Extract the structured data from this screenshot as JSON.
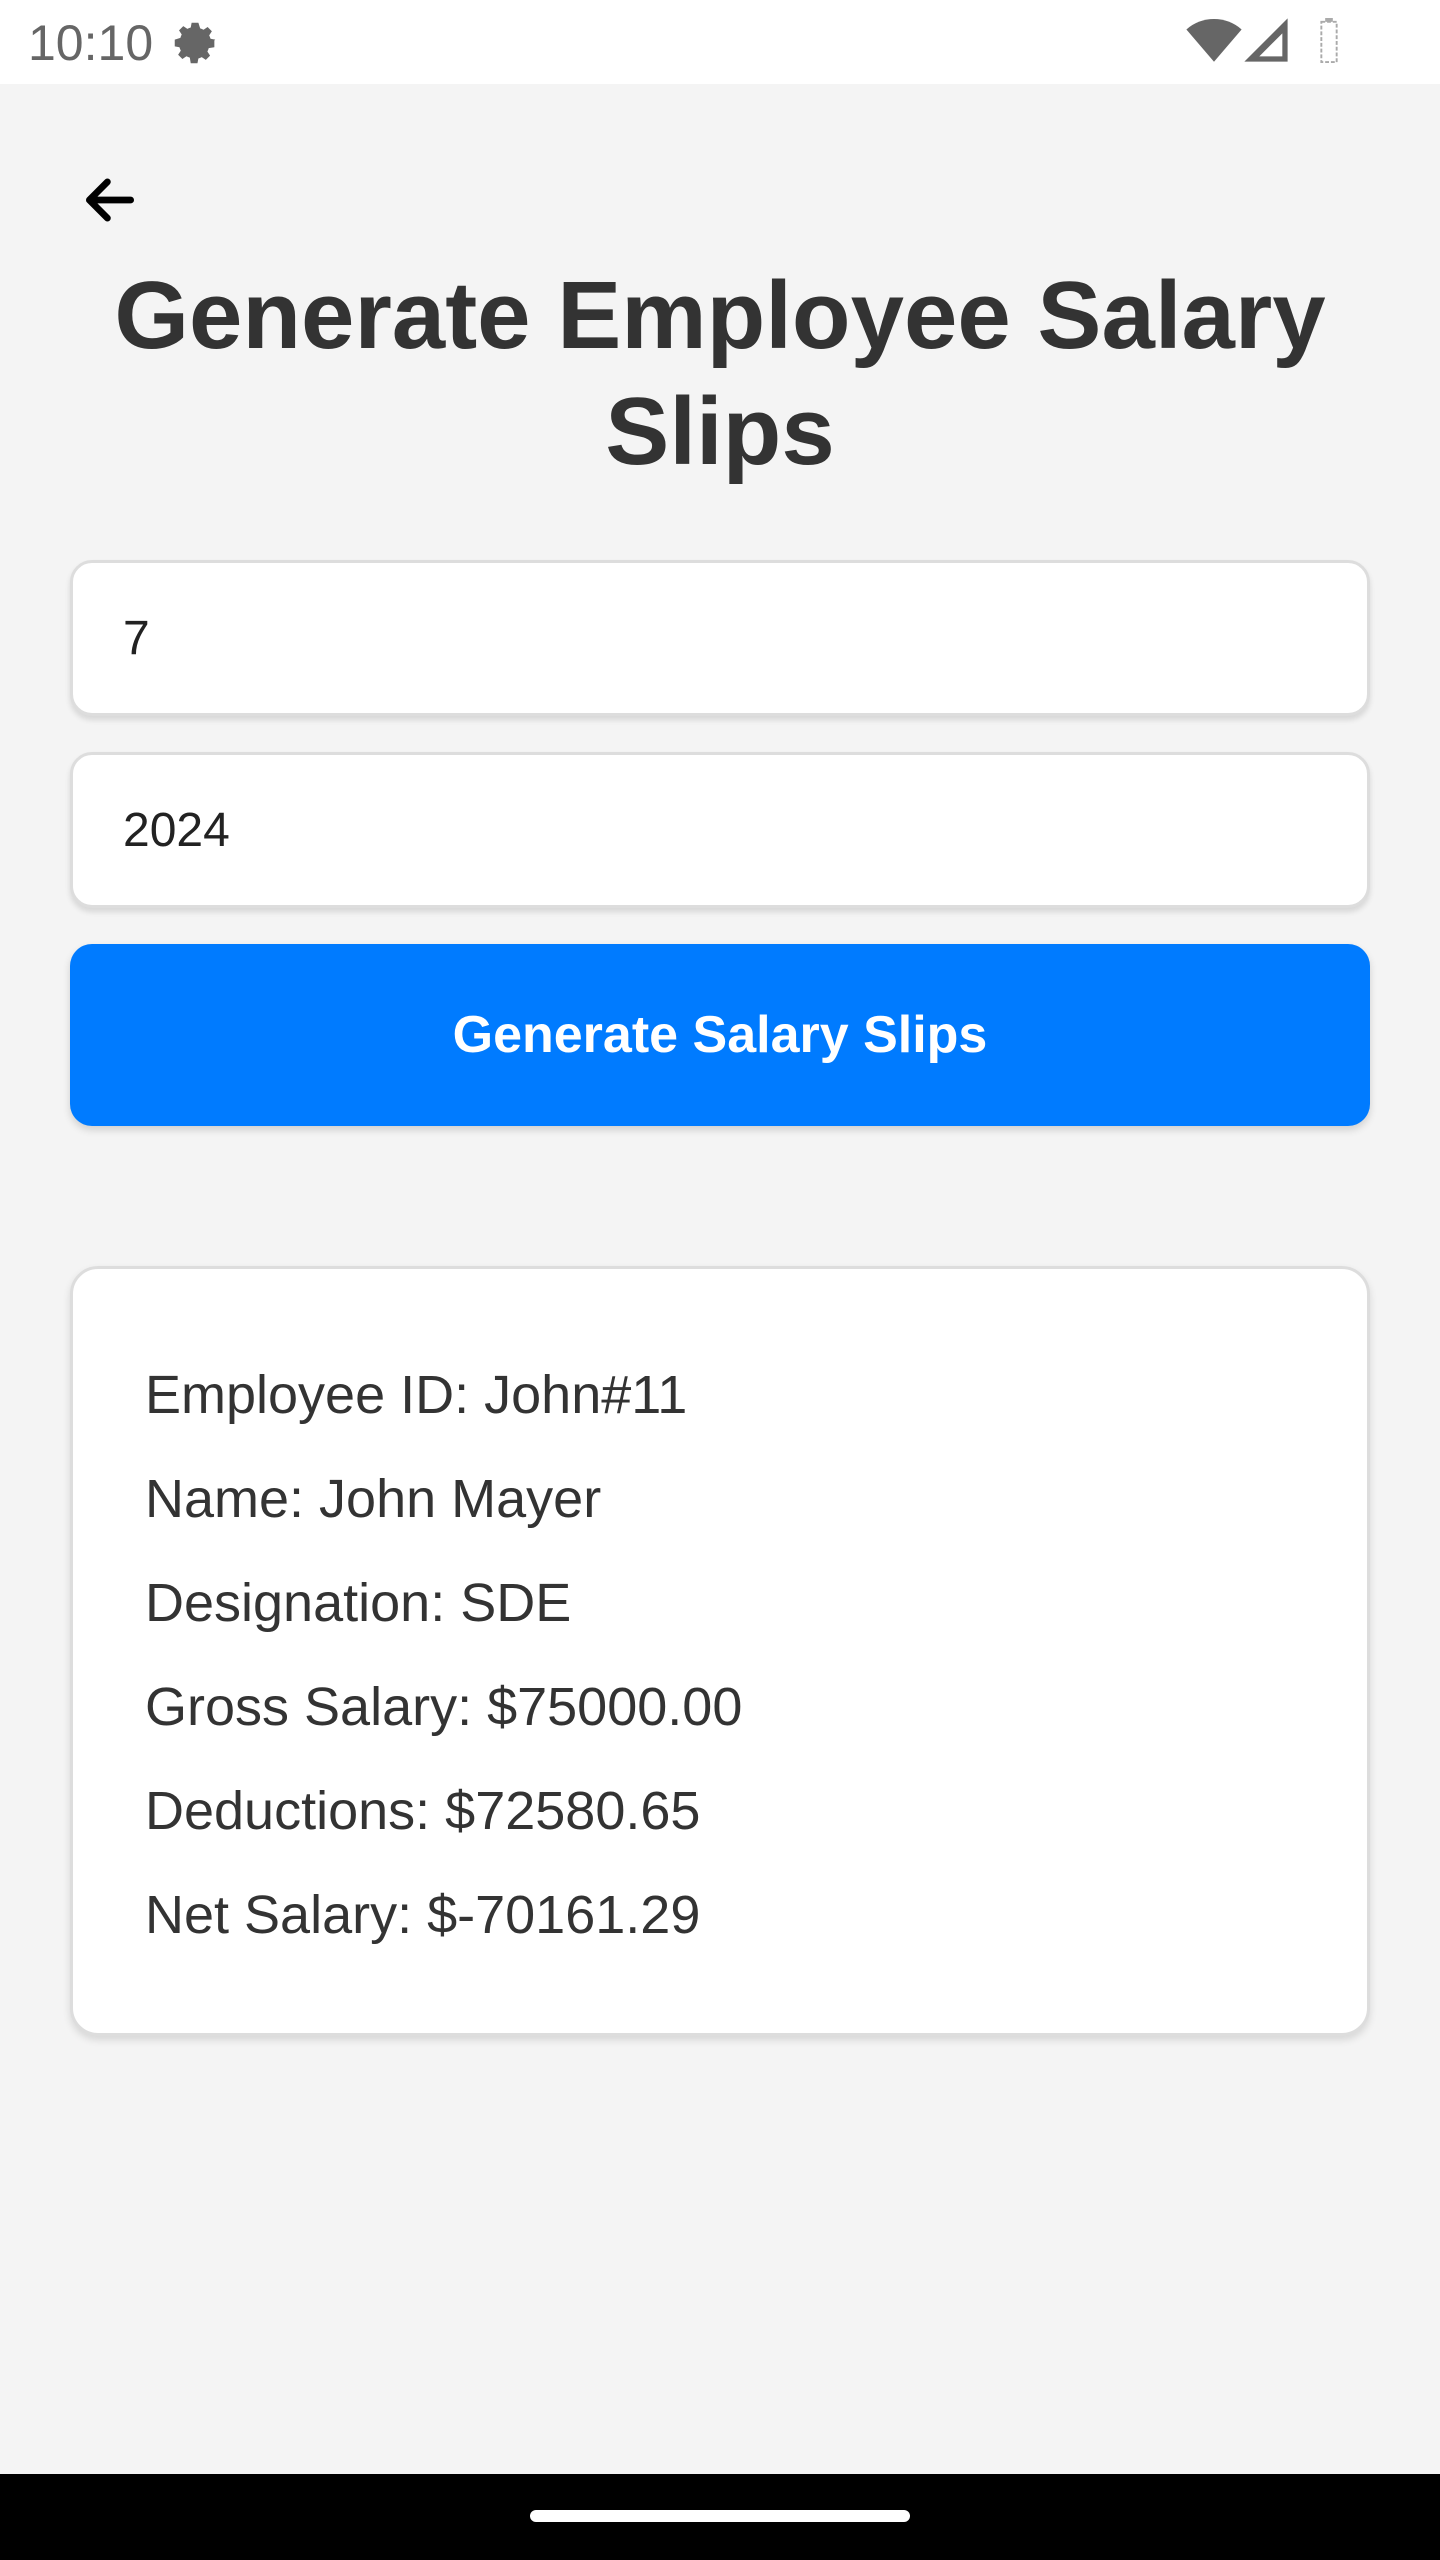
{
  "status_bar": {
    "time": "10:10",
    "icons": [
      "gear-icon",
      "wifi-icon",
      "signal-icon",
      "battery-icon"
    ]
  },
  "header": {
    "back_icon": "arrow-left-icon",
    "title": "Generate Employee Salary Slips"
  },
  "form": {
    "month_value": "7",
    "year_value": "2024",
    "generate_label": "Generate Salary Slips"
  },
  "slip": {
    "employee_id": "Employee ID: John#11",
    "name": "Name: John Mayer",
    "designation": "Designation: SDE",
    "gross_salary": "Gross Salary: $75000.00",
    "deductions": "Deductions: $72580.65",
    "net_salary": "Net Salary: $-70161.29"
  },
  "colors": {
    "accent": "#007bff",
    "background": "#f4f4f4",
    "card": "#ffffff",
    "text": "#333333"
  }
}
